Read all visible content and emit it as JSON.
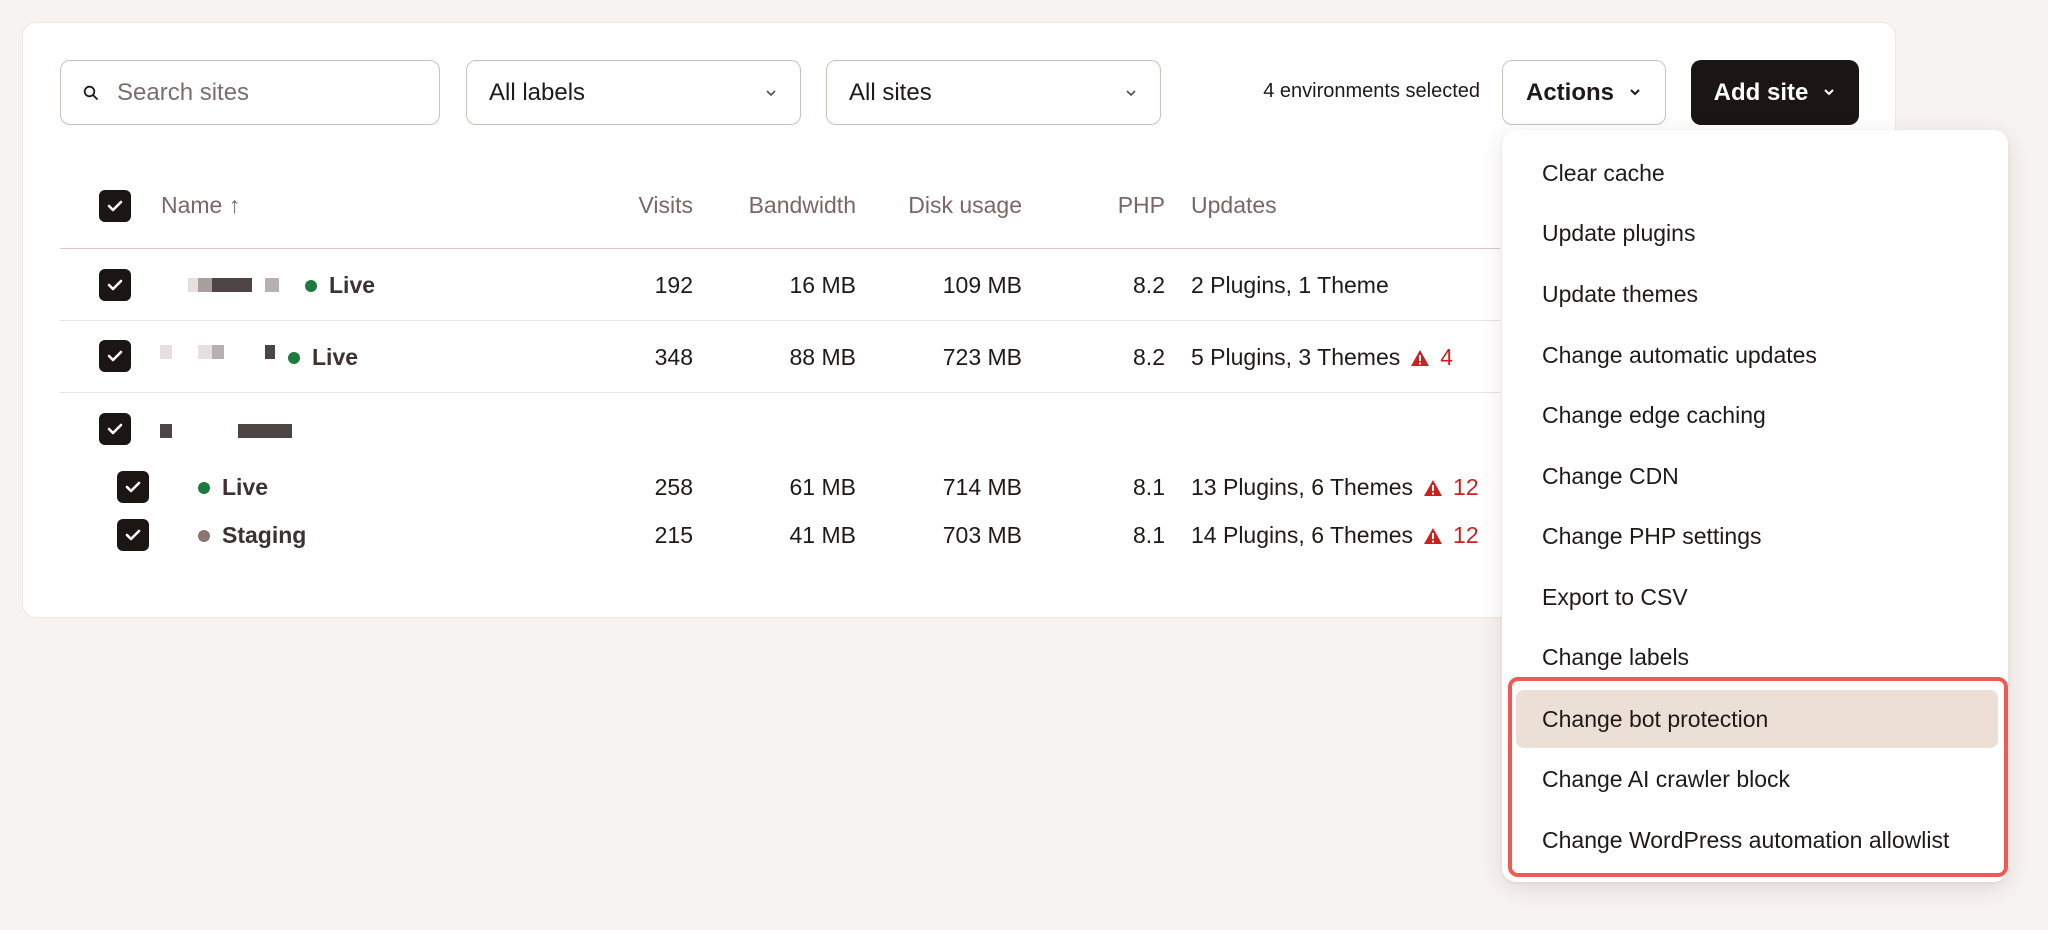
{
  "toolbar": {
    "search_placeholder": "Search sites",
    "labels_filter": "All labels",
    "sites_filter": "All sites",
    "selected_count": "4 environments selected",
    "actions_label": "Actions",
    "add_site_label": "Add site"
  },
  "table": {
    "headers": {
      "name": "Name ↑",
      "visits": "Visits",
      "bandwidth": "Bandwidth",
      "disk": "Disk usage",
      "php": "PHP",
      "updates": "Updates"
    },
    "rows": [
      {
        "env": "Live",
        "visits": "192",
        "bandwidth": "16 MB",
        "disk": "109 MB",
        "php": "8.2",
        "updates": "2 Plugins, 1 Theme",
        "warnings": ""
      },
      {
        "env": "Live",
        "visits": "348",
        "bandwidth": "88 MB",
        "disk": "723 MB",
        "php": "8.2",
        "updates": "5 Plugins, 3 Themes",
        "warnings": "4"
      },
      {
        "env": "Live",
        "visits": "258",
        "bandwidth": "61 MB",
        "disk": "714 MB",
        "php": "8.1",
        "updates": "13 Plugins, 6 Themes",
        "warnings": "12"
      },
      {
        "env": "Staging",
        "visits": "215",
        "bandwidth": "41 MB",
        "disk": "703 MB",
        "php": "8.1",
        "updates": "14 Plugins, 6 Themes",
        "warnings": "12"
      }
    ]
  },
  "actions_menu": {
    "items": [
      "Clear cache",
      "Update plugins",
      "Update themes",
      "Change automatic updates",
      "Change edge caching",
      "Change CDN",
      "Change PHP settings",
      "Export to CSV",
      "Change labels",
      "Change bot protection",
      "Change AI crawler block",
      "Change WordPress automation allowlist"
    ],
    "highlighted_index": 9
  },
  "colors": {
    "accent_dark": "#1b1514",
    "live": "#1e7a3e",
    "staging": "#8b7471",
    "warning": "#d01f1f",
    "highlight_border": "#ef5a52"
  }
}
